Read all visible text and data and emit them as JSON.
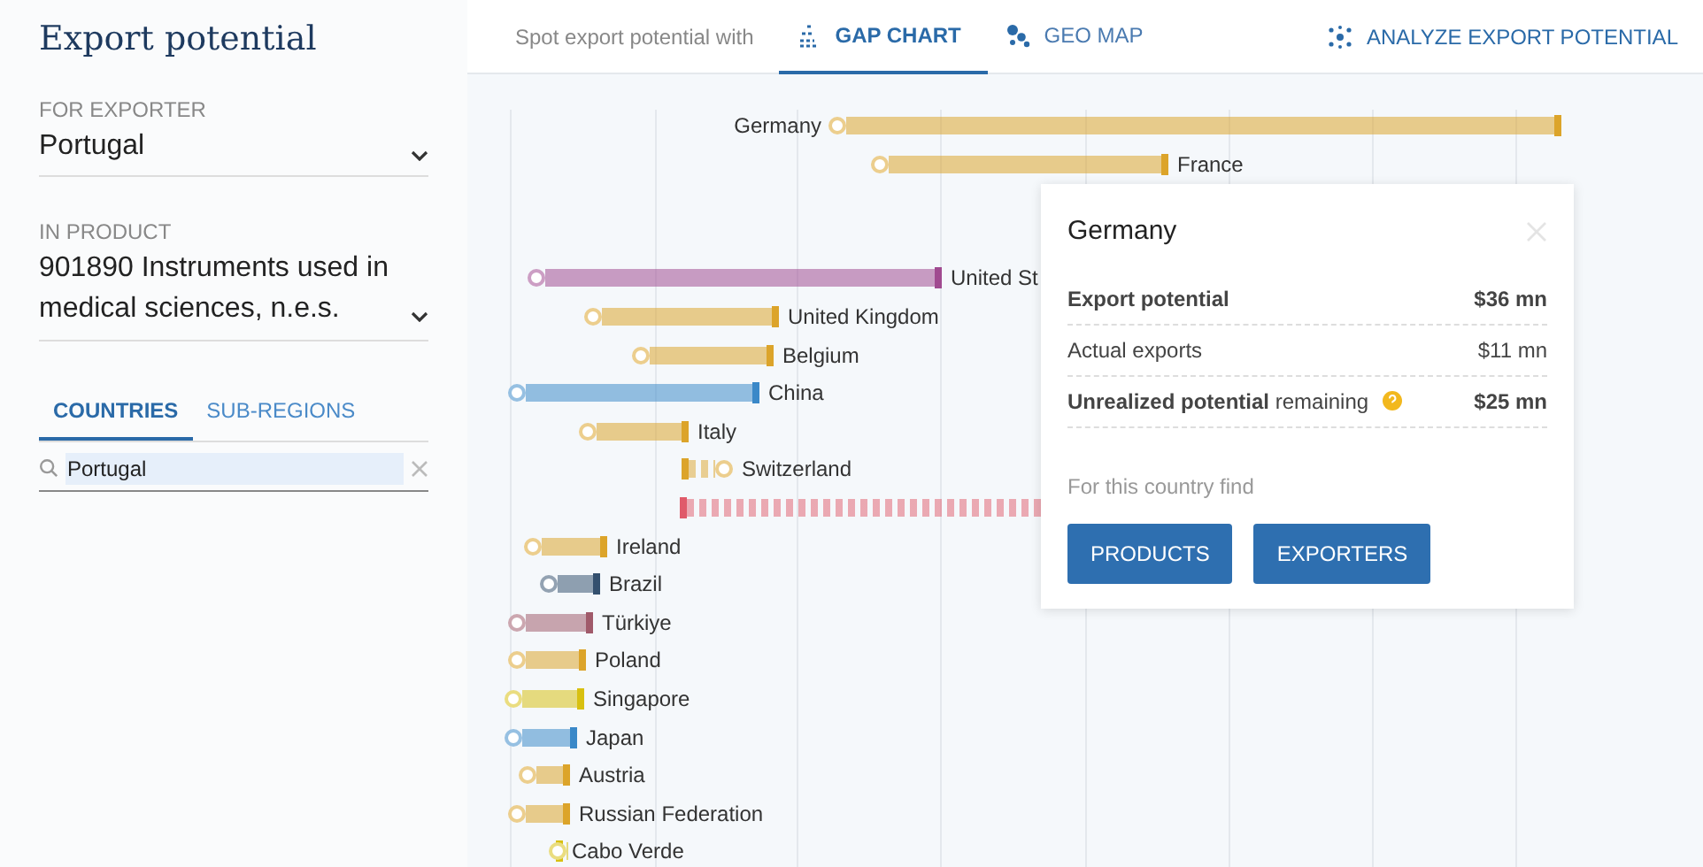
{
  "title": "Export potential",
  "exporter": {
    "label": "FOR EXPORTER",
    "value": "Portugal"
  },
  "product": {
    "label": "IN PRODUCT",
    "value": "901890 Instruments used in medical sciences, n.e.s."
  },
  "list_tabs": [
    {
      "label": "COUNTRIES",
      "selected": true
    },
    {
      "label": "SUB-REGIONS",
      "selected": false
    }
  ],
  "search": {
    "value": "Portugal"
  },
  "view_tabs": {
    "intro": "Spot export potential with",
    "tabs": [
      {
        "label": "GAP CHART",
        "selected": true
      },
      {
        "label": "GEO MAP",
        "selected": false
      }
    ],
    "action": "ANALYZE EXPORT POTENTIAL"
  },
  "rows": [
    {
      "name": "Germany",
      "color": "#dca42a",
      "kind": "solid"
    },
    {
      "name": "France",
      "color": "#dca42a",
      "kind": "solid"
    },
    {
      "name": "United St",
      "color": "#a04a90",
      "kind": "solid"
    },
    {
      "name": "United Kingdom",
      "color": "#dca42a",
      "kind": "solid"
    },
    {
      "name": "Belgium",
      "color": "#dca42a",
      "kind": "solid"
    },
    {
      "name": "China",
      "color": "#3a88c8",
      "kind": "solid"
    },
    {
      "name": "Italy",
      "color": "#dca42a",
      "kind": "solid"
    },
    {
      "name": "Switzerland",
      "color": "#dca42a",
      "kind": "dashed"
    },
    {
      "color": "#e05a6a",
      "kind": "dashed"
    },
    {
      "name": "Ireland",
      "color": "#dca42a",
      "kind": "solid"
    },
    {
      "name": "Brazil",
      "color": "#34506e",
      "kind": "solid"
    },
    {
      "name": "Türkiye",
      "color": "#a05a6a",
      "kind": "solid"
    },
    {
      "name": "Poland",
      "color": "#dca42a",
      "kind": "solid"
    },
    {
      "name": "Singapore",
      "color": "#d8c010",
      "kind": "solid"
    },
    {
      "name": "Japan",
      "color": "#3a88c8",
      "kind": "solid"
    },
    {
      "name": "Austria",
      "color": "#dca42a",
      "kind": "solid"
    },
    {
      "name": "Russian Federation",
      "color": "#dca42a",
      "kind": "solid"
    },
    {
      "name": "Cabo Verde",
      "color": "#d8c010",
      "kind": "solid"
    }
  ],
  "popup": {
    "title": "Germany",
    "rows": [
      {
        "label": "Export potential",
        "value": "$36 mn",
        "kind": "bold"
      },
      {
        "label": "Actual exports",
        "value": "$11 mn",
        "kind": "plain"
      },
      {
        "label": "**Unrealized potential** remaining",
        "value": "$25 mn",
        "kind": "help"
      }
    ],
    "find": "For this country find",
    "buttons": [
      "PRODUCTS",
      "EXPORTERS"
    ]
  }
}
